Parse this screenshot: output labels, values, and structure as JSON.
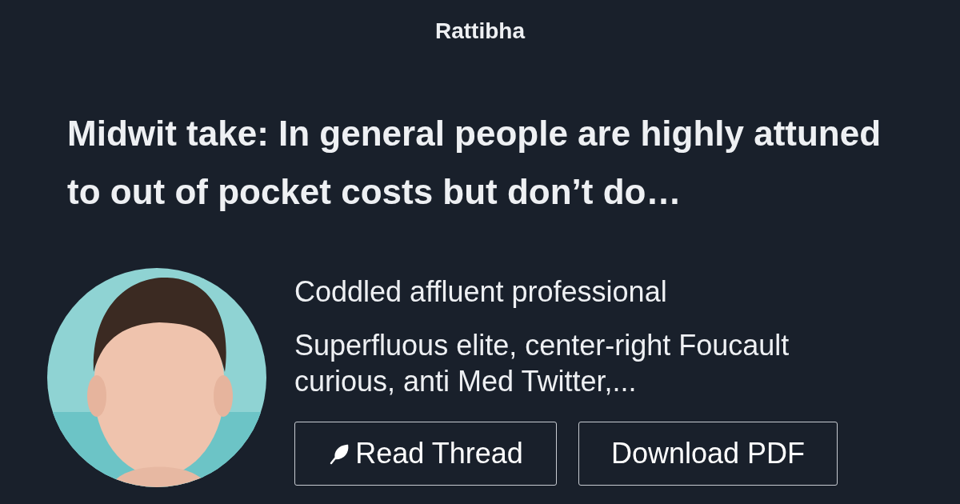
{
  "site": {
    "name": "Rattibha"
  },
  "thread": {
    "title": "Midwit take: In general people are highly attuned to out of pocket costs but don’t do…"
  },
  "author": {
    "name": "Coddled affluent professional",
    "bio": "Superfluous elite, center-right Foucault curious, anti Med Twitter,..."
  },
  "buttons": [
    {
      "kind": "read",
      "label": "Read Thread"
    },
    {
      "kind": "download",
      "label": "Download PDF"
    }
  ]
}
